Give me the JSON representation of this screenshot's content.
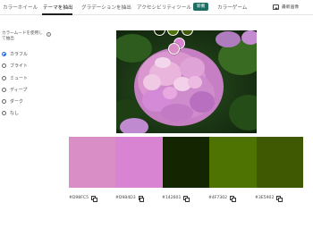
{
  "nav": {
    "tabs": [
      {
        "label": "カラーホイール",
        "active": false
      },
      {
        "label": "テーマを抽出",
        "active": true
      },
      {
        "label": "グラデーションを抽出",
        "active": false
      },
      {
        "label": "アクセシビリティツール",
        "active": false
      },
      {
        "label": "カラーゲーム",
        "active": false
      }
    ],
    "new_badge": "新機",
    "upload_label": "最新画像",
    "upload_icon": "image-upload-icon"
  },
  "left_panel": {
    "description": "カラームードを使用して抽出",
    "info_icon": "info-icon",
    "modes": [
      {
        "label": "カラフル",
        "selected": true
      },
      {
        "label": "ブライト",
        "selected": false
      },
      {
        "label": "ミュート",
        "selected": false
      },
      {
        "label": "ディープ",
        "selected": false
      },
      {
        "label": "ダーク",
        "selected": false
      },
      {
        "label": "なし",
        "selected": false
      }
    ]
  },
  "markers": [
    "#D98FC5",
    "#D984D3",
    "#142601",
    "#4F7302",
    "#3E5902"
  ],
  "palette": [
    {
      "hex": "#D98FC5",
      "color": "#D98FC5"
    },
    {
      "hex": "#D984D3",
      "color": "#D984D3"
    },
    {
      "hex": "#142601",
      "color": "#142601"
    },
    {
      "hex": "#4F7302",
      "color": "#4F7302"
    },
    {
      "hex": "#3E5902",
      "color": "#3E5902"
    }
  ]
}
